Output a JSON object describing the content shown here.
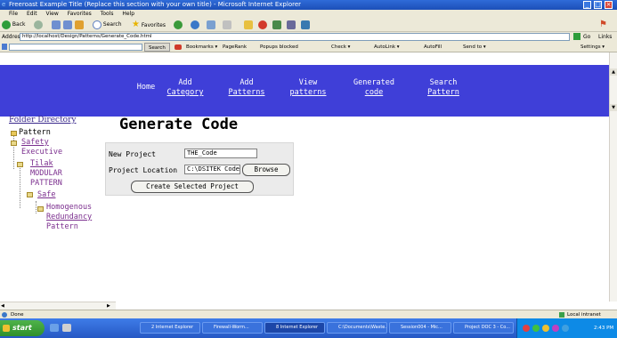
{
  "window": {
    "title": "Freeroast Example Title (Replace this section with your own title) - Microsoft Internet Explorer",
    "menu": [
      "File",
      "Edit",
      "View",
      "Favorites",
      "Tools",
      "Help"
    ]
  },
  "toolbar": {
    "back_label": "Back",
    "search_label": "Search",
    "favorites_label": "Favorites"
  },
  "address": {
    "label": "Address",
    "value": "http://localhost/Design/Patterns/Generate_Code.html",
    "go_label": "Go",
    "links_label": "Links"
  },
  "google": {
    "search_label": "Search",
    "items": [
      "Bookmarks ▾",
      "PageRank",
      "Popups blocked",
      "Check ▾",
      "AutoLink ▾",
      "AutoFill",
      "Send to ▾"
    ],
    "settings_label": "Settings ▾"
  },
  "nav": {
    "items": [
      {
        "l1": "Home",
        "l2": ""
      },
      {
        "l1": "Add",
        "l2": "Category"
      },
      {
        "l1": "Add",
        "l2": "Patterns"
      },
      {
        "l1": "View",
        "l2": "patterns"
      },
      {
        "l1": "Generated",
        "l2": "code"
      },
      {
        "l1": "Search",
        "l2": "Pattern"
      }
    ]
  },
  "folder": {
    "title": "Folder Directory",
    "tree": {
      "root": "Pattern",
      "n1": "Safety",
      "n1b": "Executive",
      "n2": "Tilak",
      "n2b": "MODULAR",
      "n2c": "PATTERN",
      "n3": "Safe",
      "n4": "Homogenous",
      "n4b": "Redundancy",
      "n4c": "Pattern"
    }
  },
  "main": {
    "heading": "Generate Code",
    "form": {
      "new_project_label": "New Project",
      "new_project_value": "THE_Code",
      "location_label": "Project Location",
      "location_value": "C:\\DSITEK Code",
      "browse_label": "Browse",
      "generate_label": "Create Selected Project"
    }
  },
  "status": {
    "left": "Done",
    "zone": "Local intranet"
  },
  "taskbar": {
    "start_label": "start",
    "tasks": [
      "2 Internet Explorer",
      "Firewall-Worm...",
      "8 Internet Explorer",
      "C:\\Documents\\Waste...",
      "Session004 - Mic...",
      "Project DOC 3 - Co..."
    ],
    "clock": "2:43 PM"
  }
}
